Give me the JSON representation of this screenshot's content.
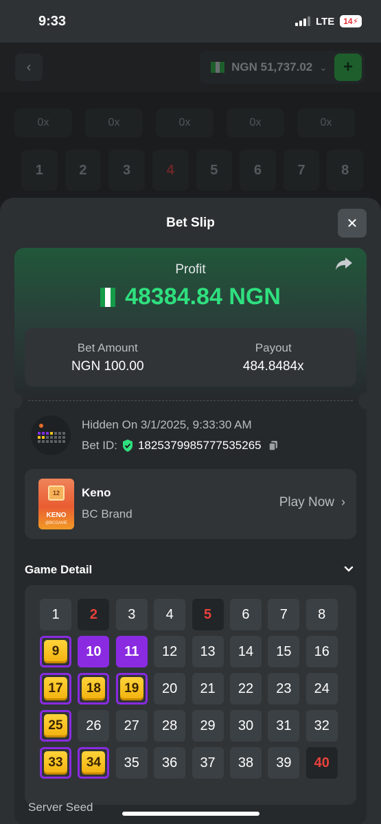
{
  "status_bar": {
    "time": "9:33",
    "network": "LTE",
    "battery": "14"
  },
  "background_game": {
    "balance": "NGN 51,737.02",
    "multipliers": [
      "0x",
      "0x",
      "0x",
      "0x",
      "0x"
    ],
    "numbers": [
      "1",
      "2",
      "3",
      "4",
      "5",
      "6",
      "7",
      "8"
    ],
    "red_number": "4"
  },
  "bet_slip": {
    "title": "Bet Slip",
    "profit_label": "Profit",
    "profit_amount": "48384.84 NGN",
    "bet_amount_label": "Bet Amount",
    "bet_amount_value": "NGN 100.00",
    "payout_label": "Payout",
    "payout_value": "484.8484x",
    "hidden_on": "Hidden On 3/1/2025, 9:33:30 AM",
    "bet_id_label": "Bet ID:",
    "bet_id_value": "1825379985777535265",
    "game": {
      "name": "Keno",
      "brand": "BC Brand",
      "play_label": "Play Now",
      "thumb_word": "KENO",
      "thumb_number": "12",
      "thumb_brand": "@BCGAME"
    },
    "game_detail_label": "Game Detail",
    "server_seed_label": "Server Seed"
  },
  "keno_grid": {
    "numbers": [
      "1",
      "2",
      "3",
      "4",
      "5",
      "6",
      "7",
      "8",
      "9",
      "10",
      "11",
      "12",
      "13",
      "14",
      "15",
      "16",
      "17",
      "18",
      "19",
      "20",
      "21",
      "22",
      "23",
      "24",
      "25",
      "26",
      "27",
      "28",
      "29",
      "30",
      "31",
      "32",
      "33",
      "34",
      "35",
      "36",
      "37",
      "38",
      "39",
      "40"
    ],
    "hits": [
      9,
      17,
      18,
      19,
      25,
      33,
      34
    ],
    "purple": [
      10,
      11
    ],
    "red_dark": [
      2,
      5
    ],
    "red_plain": [
      40
    ]
  },
  "colors": {
    "profit_green": "#2fe07e",
    "accent_purple": "#8a2be2",
    "hit_gold": "#f2b10d",
    "red": "#e8413c"
  }
}
